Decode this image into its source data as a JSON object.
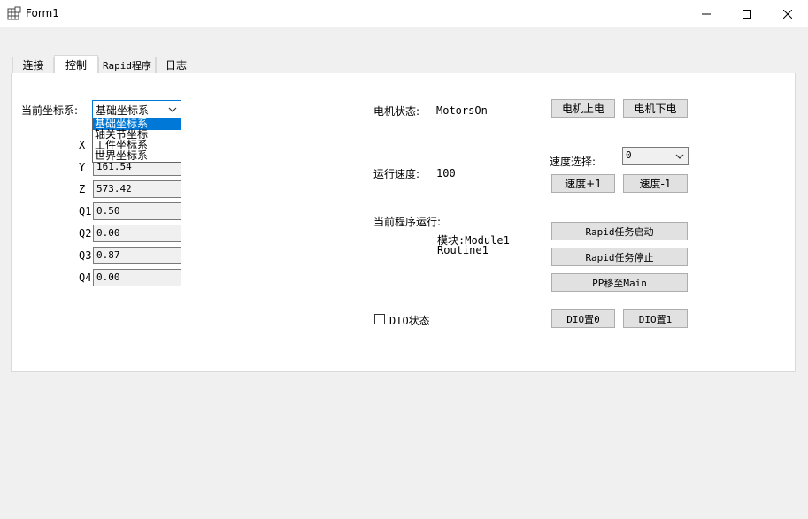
{
  "window": {
    "title": "Form1"
  },
  "tabs": [
    {
      "label": "连接"
    },
    {
      "label": "控制"
    },
    {
      "label": "Rapid程序"
    },
    {
      "label": "日志"
    }
  ],
  "coord": {
    "label": "当前坐标系:",
    "selected": "基础坐标系",
    "options": [
      "基础坐标系",
      "轴关节坐标",
      "工件坐标系",
      "世界坐标系"
    ]
  },
  "fields": [
    {
      "label": "X",
      "value": ""
    },
    {
      "label": "Y",
      "value": "161.54"
    },
    {
      "label": "Z",
      "value": "573.42"
    },
    {
      "label": "Q1",
      "value": "0.50"
    },
    {
      "label": "Q2",
      "value": "0.00"
    },
    {
      "label": "Q3",
      "value": "0.87"
    },
    {
      "label": "Q4",
      "value": "0.00"
    }
  ],
  "motor": {
    "label": "电机状态:",
    "value": "MotorsOn",
    "on_button": "电机上电",
    "off_button": "电机下电"
  },
  "speed": {
    "label": "运行速度:",
    "value": "100",
    "select_label": "速度选择:",
    "select_value": "0",
    "plus_button": "速度+1",
    "minus_button": "速度-1"
  },
  "program": {
    "label": "当前程序运行:",
    "module": "模块:Module1",
    "routine": "Routine1",
    "start_button": "Rapid任务启动",
    "stop_button": "Rapid任务停止",
    "pp_button": "PP移至Main"
  },
  "dio": {
    "label": "DIO状态",
    "set0_button": "DIO置0",
    "set1_button": "DIO置1"
  }
}
